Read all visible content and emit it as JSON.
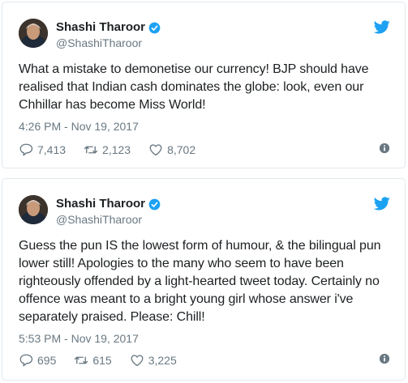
{
  "colors": {
    "twitter_blue": "#1da1f2",
    "icon_gray": "#697882",
    "text": "#1c2022",
    "border": "#e1e8ed"
  },
  "tweets": [
    {
      "display_name": "Shashi Tharoor",
      "handle": "@ShashiTharoor",
      "text": "What a mistake to demonetise our currency! BJP should have realised that Indian cash dominates the globe: look, even our Chhillar has become Miss World!",
      "timestamp": "4:26 PM - Nov 19, 2017",
      "replies": "7,413",
      "retweets": "2,123",
      "likes": "8,702",
      "icons": [
        "avatar",
        "verified-icon",
        "twitter-bird-icon",
        "reply-icon",
        "retweet-icon",
        "heart-icon",
        "info-icon"
      ]
    },
    {
      "display_name": "Shashi Tharoor",
      "handle": "@ShashiTharoor",
      "text": "Guess the pun IS the lowest form of humour, & the bilingual pun lower still! Apologies to the many who seem to have been righteously offended by a light-hearted tweet today. Certainly no offence was meant to a bright young girl whose answer i've separately praised. Please: Chill!",
      "timestamp": "5:53 PM - Nov 19, 2017",
      "replies": "695",
      "retweets": "615",
      "likes": "3,225",
      "icons": [
        "avatar",
        "verified-icon",
        "twitter-bird-icon",
        "reply-icon",
        "retweet-icon",
        "heart-icon",
        "info-icon"
      ]
    }
  ]
}
